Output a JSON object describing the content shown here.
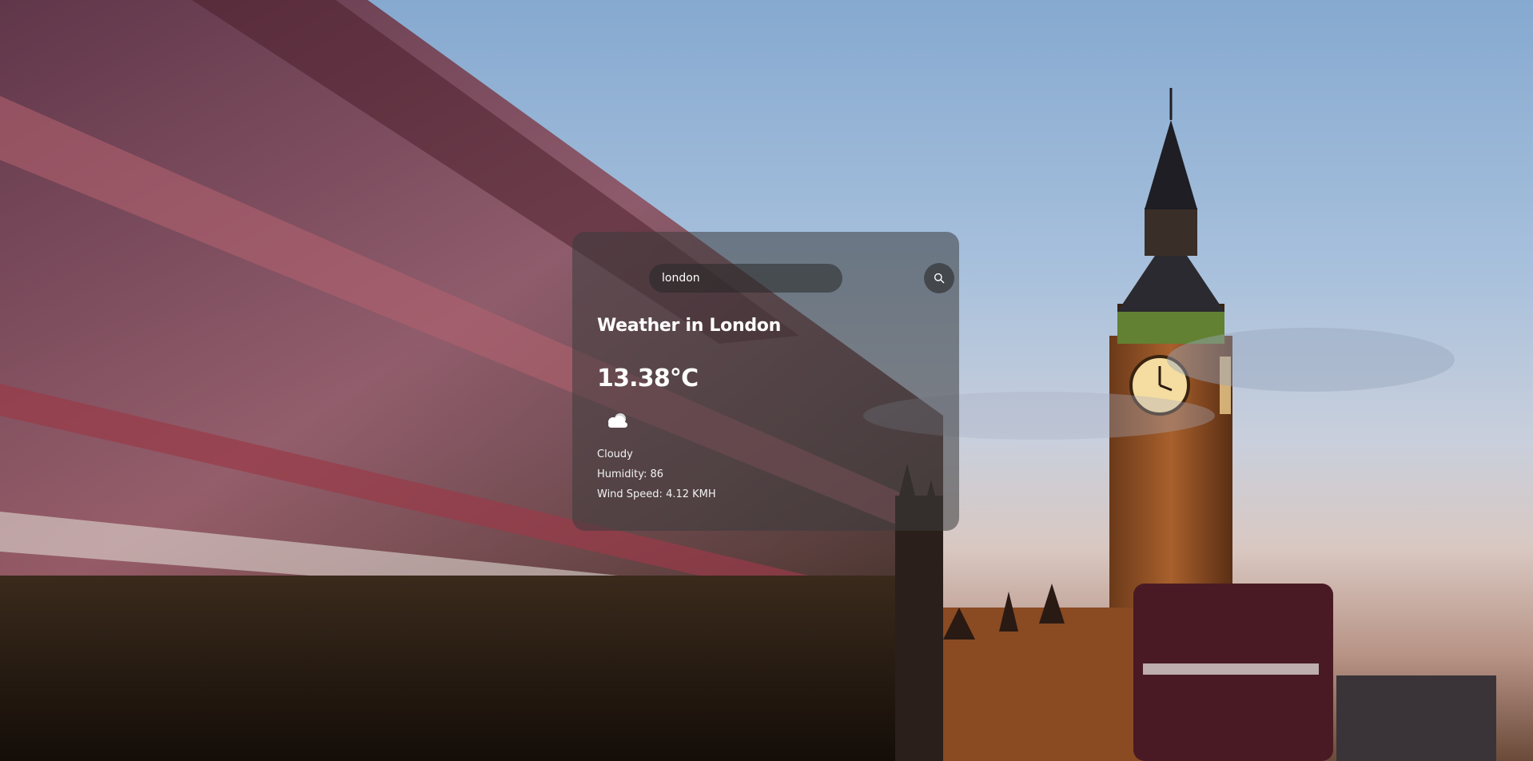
{
  "background": {
    "image": "london-big-ben-bus-background"
  },
  "search": {
    "value": "london",
    "button_icon": "search-icon"
  },
  "weather": {
    "title": "Weather in London",
    "temperature": "13.38°C",
    "condition_icon": "cloud-icon",
    "description": "Cloudy",
    "humidity": "Humidity: 86",
    "wind": "Wind Speed: 4.12 KMH"
  },
  "colors": {
    "card_background": "#3c3c3c",
    "text": "#ffffff"
  }
}
